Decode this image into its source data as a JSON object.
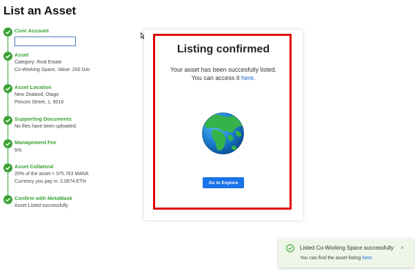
{
  "page": {
    "title": "List an Asset"
  },
  "steps": [
    {
      "title": "Civic Account",
      "details": []
    },
    {
      "title": "Asset",
      "details": [
        "Category: Real Estate",
        "Co-Working Space, Value: 200 DAI"
      ]
    },
    {
      "title": "Asset Location",
      "details": [
        "New Zealand, Otago",
        "Princes Street, 1, 9016"
      ]
    },
    {
      "title": "Supporting Documents",
      "details": [
        "No files have been uploaded."
      ]
    },
    {
      "title": "Management Fee",
      "details": [
        "5%"
      ]
    },
    {
      "title": "Asset Collateral",
      "details": [
        "20% of the asset = 375.763 MANA",
        "Currency you pay in: 0.0674 ETH"
      ]
    },
    {
      "title": "Confirm with MetaMask",
      "details": [
        "Asset Listed successfully"
      ]
    }
  ],
  "civic_input": {
    "value": ""
  },
  "modal": {
    "title": "Listing confirmed",
    "message_line1": "Your asset has been succesfully listed.",
    "message_line2_prefix": "You can access it ",
    "message_link": "here",
    "message_line2_suffix": ".",
    "button_label": "Go to Explore"
  },
  "toast": {
    "title": "Listed Co-Working Space successfully",
    "text_prefix": "You can find the asset listing ",
    "link": "here",
    "text_suffix": ".",
    "close_label": "×"
  },
  "colors": {
    "success_green": "#3aa335",
    "highlight_red": "#e00000",
    "primary_blue": "#1a73e8",
    "toast_bg": "#eef6e8"
  },
  "icons": [
    "check-circle-icon",
    "cursor-icon",
    "globe-icon",
    "close-icon"
  ]
}
